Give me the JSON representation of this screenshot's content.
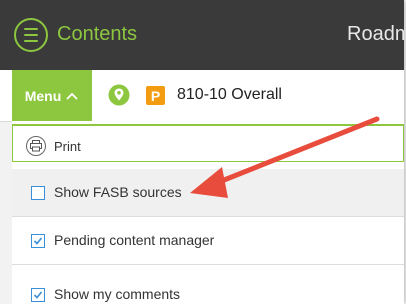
{
  "header": {
    "contents_label": "Contents",
    "roadmap_label": "Roadm"
  },
  "toolbar": {
    "menu_label": "Menu",
    "p_badge": "P",
    "doc_title": "810-10 Overall"
  },
  "dropdown": {
    "print_label": "Print",
    "items": [
      {
        "label": "Show FASB sources",
        "checked": false
      },
      {
        "label": "Pending content manager",
        "checked": true
      },
      {
        "label": "Show my comments",
        "checked": true
      }
    ]
  },
  "colors": {
    "brand_green": "#8dc63f",
    "header_bg": "#3a3a3a",
    "checkbox_blue": "#3b8fd6",
    "p_orange": "#f39c12",
    "arrow_red": "#e74c3c"
  },
  "icons": [
    "contents-menu-icon",
    "chevron-up-icon",
    "location-pin-icon",
    "print-icon",
    "checkbox-icon",
    "annotation-arrow"
  ]
}
